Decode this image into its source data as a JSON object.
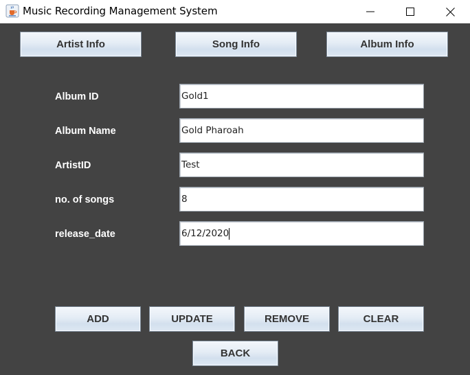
{
  "window": {
    "title": "Music Recording Management System",
    "icon": "java-coffee-cup-icon",
    "controls": [
      "minimize-icon",
      "maximize-icon",
      "close-icon"
    ]
  },
  "nav": {
    "artist_label": "Artist Info",
    "song_label": "Song Info",
    "album_label": "Album Info"
  },
  "form": {
    "album_id": {
      "label": "Album ID",
      "value": "Gold1"
    },
    "album_name": {
      "label": "Album Name",
      "value": "Gold Pharoah"
    },
    "artist_id": {
      "label": "ArtistID",
      "value": "Test"
    },
    "num_songs": {
      "label": "no. of songs",
      "value": "8"
    },
    "release_date": {
      "label": "release_date",
      "value": "6/12/2020"
    }
  },
  "actions": {
    "add_label": "ADD",
    "update_label": "UPDATE",
    "remove_label": "REMOVE",
    "clear_label": "CLEAR",
    "back_label": "BACK"
  },
  "colors": {
    "panel_background": "#434343",
    "label_text": "#ffffff",
    "button_text": "#333333"
  }
}
